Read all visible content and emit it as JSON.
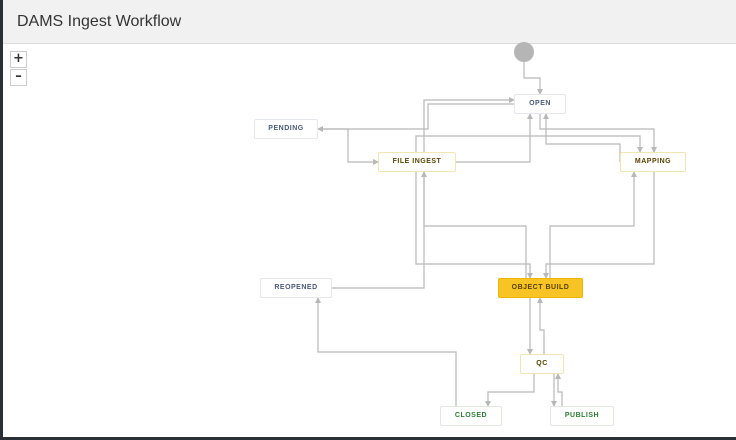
{
  "window": {
    "title": "DAMS Ingest Workflow"
  },
  "zoom": {
    "in_label": "+",
    "out_label": "–"
  },
  "colors": {
    "connector": "#b8b8b8",
    "active_status": "#f7c325",
    "done_text": "#2e7d32",
    "todo_text": "#4a5a78",
    "start_node": "#b5b5b5"
  },
  "workflow": {
    "statuses": {
      "open": "OPEN",
      "pending": "PENDING",
      "file_ingest": "FILE INGEST",
      "mapping": "MAPPING",
      "reopened": "REOPENED",
      "object_build": "OBJECT BUILD",
      "qc": "QC",
      "closed": "CLOSED",
      "publish": "PUBLISH"
    },
    "selected_status": "OBJECT BUILD"
  }
}
